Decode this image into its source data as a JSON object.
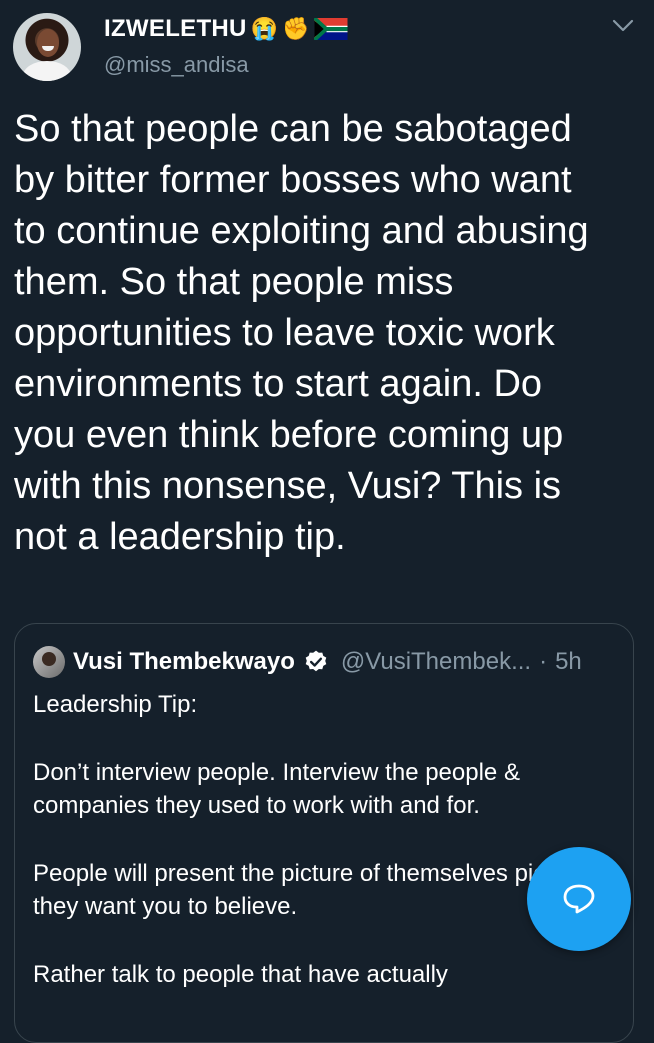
{
  "author": {
    "name": "IZWELETHU",
    "emojis": [
      "😭",
      "✊"
    ],
    "flag_icon": "south-africa-flag-icon",
    "handle": "@miss_andisa",
    "avatar_icon": "user-avatar"
  },
  "tweet": {
    "text": "So that people can be sabotaged\nby bitter former bosses who want\nto continue exploiting and abusing\nthem. So that people miss\nopportunities to leave toxic work\nenvironments to start again. Do\nyou even think before coming up\nwith this nonsense, Vusi? This is\nnot a leadership tip."
  },
  "quoted": {
    "name": "Vusi Thembekwayo",
    "verified_icon": "verified-badge-icon",
    "handle": "@VusiThembek...",
    "dot": "·",
    "time": "5h",
    "paragraphs": [
      "Leadership Tip:",
      "Don’t interview people. Interview the people & companies they used to work with and for.",
      "People will present the picture of themselves picture they want you to believe.",
      "Rather talk to people that have actually"
    ]
  },
  "actions": {
    "more_icon": "chevron-down-icon",
    "compose_icon": "reply-bubble-icon"
  },
  "colors": {
    "background": "#15202b",
    "accent": "#1da1f2",
    "secondary_text": "#8899a6",
    "border": "#38444d"
  }
}
